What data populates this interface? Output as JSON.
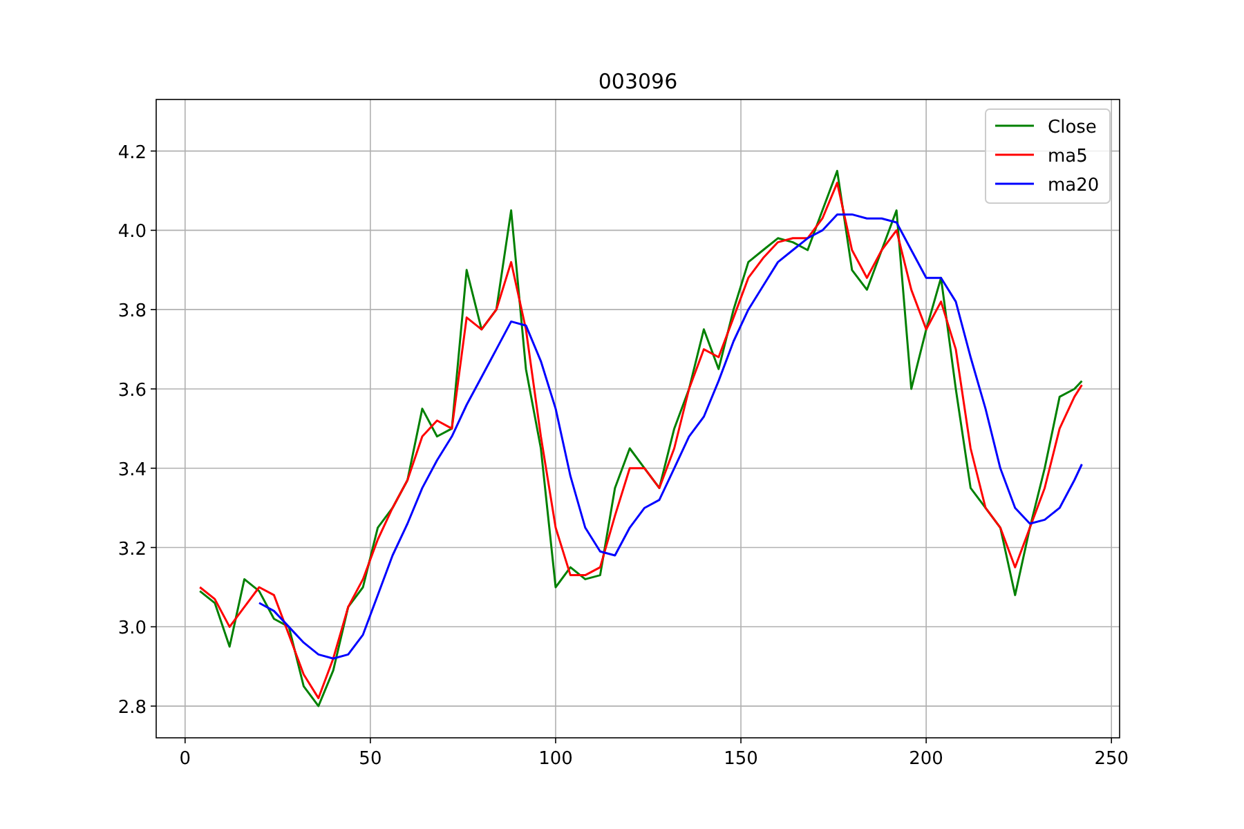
{
  "chart": {
    "chart_data": {
      "type": "line",
      "title": "003096",
      "x": [
        4,
        8,
        12,
        16,
        20,
        24,
        28,
        32,
        36,
        40,
        44,
        48,
        52,
        56,
        60,
        64,
        68,
        72,
        76,
        80,
        84,
        88,
        92,
        96,
        100,
        104,
        108,
        112,
        116,
        120,
        124,
        128,
        132,
        136,
        140,
        144,
        148,
        152,
        156,
        160,
        164,
        168,
        172,
        176,
        180,
        184,
        188,
        192,
        196,
        200,
        204,
        208,
        212,
        216,
        220,
        224,
        228,
        232,
        236,
        240,
        242
      ],
      "series": [
        {
          "name": "Close",
          "color": "#008000",
          "values": [
            3.09,
            3.06,
            2.95,
            3.12,
            3.09,
            3.02,
            3.0,
            2.85,
            2.8,
            2.89,
            3.05,
            3.1,
            3.25,
            3.3,
            3.37,
            3.55,
            3.48,
            3.5,
            3.9,
            3.75,
            3.8,
            4.05,
            3.65,
            3.45,
            3.1,
            3.15,
            3.12,
            3.13,
            3.35,
            3.45,
            3.4,
            3.35,
            3.5,
            3.6,
            3.75,
            3.65,
            3.8,
            3.92,
            3.95,
            3.98,
            3.97,
            3.95,
            4.05,
            4.15,
            3.9,
            3.85,
            3.95,
            4.05,
            3.6,
            3.75,
            3.88,
            3.6,
            3.35,
            3.3,
            3.25,
            3.08,
            3.25,
            3.4,
            3.58,
            3.6,
            3.62
          ]
        },
        {
          "name": "ma5",
          "color": "#ff0000",
          "values": [
            3.1,
            3.07,
            3.0,
            3.05,
            3.1,
            3.08,
            2.98,
            2.88,
            2.82,
            2.92,
            3.05,
            3.12,
            3.22,
            3.3,
            3.37,
            3.48,
            3.52,
            3.5,
            3.78,
            3.75,
            3.8,
            3.92,
            3.75,
            3.48,
            3.25,
            3.13,
            3.13,
            3.15,
            3.28,
            3.4,
            3.4,
            3.35,
            3.45,
            3.6,
            3.7,
            3.68,
            3.78,
            3.88,
            3.93,
            3.97,
            3.98,
            3.98,
            4.03,
            4.12,
            3.95,
            3.88,
            3.95,
            4.0,
            3.85,
            3.75,
            3.82,
            3.7,
            3.45,
            3.3,
            3.25,
            3.15,
            3.25,
            3.35,
            3.5,
            3.58,
            3.61
          ]
        },
        {
          "name": "ma20",
          "color": "#0000ff",
          "values": [
            null,
            null,
            null,
            null,
            3.06,
            3.04,
            3.0,
            2.96,
            2.93,
            2.92,
            2.93,
            2.98,
            3.08,
            3.18,
            3.26,
            3.35,
            3.42,
            3.48,
            3.56,
            3.63,
            3.7,
            3.77,
            3.76,
            3.67,
            3.55,
            3.38,
            3.25,
            3.19,
            3.18,
            3.25,
            3.3,
            3.32,
            3.4,
            3.48,
            3.53,
            3.62,
            3.72,
            3.8,
            3.86,
            3.92,
            3.95,
            3.98,
            4.0,
            4.04,
            4.04,
            4.03,
            4.03,
            4.02,
            3.95,
            3.88,
            3.88,
            3.82,
            3.68,
            3.55,
            3.4,
            3.3,
            3.26,
            3.27,
            3.3,
            3.37,
            3.41
          ]
        }
      ],
      "xlim": [
        -7.8,
        252.2
      ],
      "ylim": [
        2.72,
        4.33
      ],
      "xticks": [
        0,
        50,
        100,
        150,
        200,
        250
      ],
      "grid": true,
      "legend": true,
      "yticks": [
        {
          "value": 2.8,
          "label": "2.8"
        },
        {
          "value": 3.0,
          "label": "3.0"
        },
        {
          "value": 3.2,
          "label": "3.2"
        },
        {
          "value": 3.4,
          "label": "3.4"
        },
        {
          "value": 3.6,
          "label": "3.6"
        },
        {
          "value": 3.8,
          "label": "3.8"
        },
        {
          "value": 4.0,
          "label": "4.0"
        },
        {
          "value": 4.2,
          "label": "4.2"
        }
      ]
    }
  }
}
